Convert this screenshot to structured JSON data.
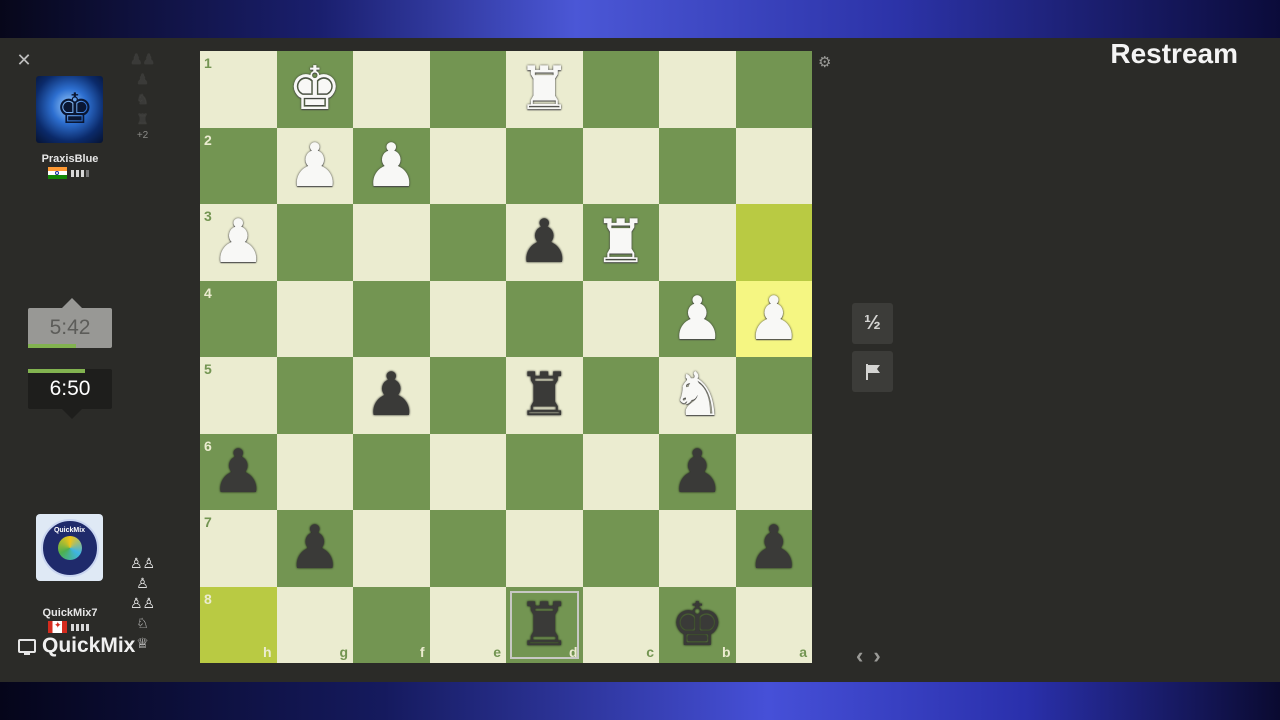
{
  "watermark": "Restream",
  "top_player": {
    "name": "PraxisBlue",
    "flag": "india-flag",
    "captured": [
      "♟♟",
      "♟",
      "♞",
      "♜"
    ],
    "captured_extra": "+2",
    "clock": "5:42"
  },
  "bottom_player": {
    "name": "QuickMix7",
    "flag": "canada-flag",
    "avatar_text": "QuickMix",
    "captured": [
      "♙♙",
      "♙",
      "♙♙",
      "♘",
      "♕"
    ],
    "clock": "6:50"
  },
  "brand": "QuickMix",
  "controls": {
    "draw_label": "½",
    "resign_icon": "flag-icon",
    "prev": "‹",
    "next": "›"
  },
  "board": {
    "orientation": "black-bottom",
    "files": [
      "h",
      "g",
      "f",
      "e",
      "d",
      "c",
      "b",
      "a"
    ],
    "ranks": [
      "1",
      "2",
      "3",
      "4",
      "5",
      "6",
      "7",
      "8"
    ],
    "rows": [
      [
        "",
        "wK",
        "",
        "",
        "wR",
        "",
        "",
        ""
      ],
      [
        "",
        "wP",
        "wP",
        "",
        "",
        "",
        "",
        ""
      ],
      [
        "wP",
        "",
        "",
        "",
        "bP",
        "wR",
        "",
        ""
      ],
      [
        "",
        "",
        "",
        "",
        "",
        "",
        "wP",
        "wP"
      ],
      [
        "",
        "",
        "bP",
        "",
        "bR",
        "",
        "wN",
        ""
      ],
      [
        "bP",
        "",
        "",
        "",
        "",
        "",
        "bP",
        ""
      ],
      [
        "",
        "bP",
        "",
        "",
        "",
        "",
        "",
        "bP"
      ],
      [
        "",
        "",
        "",
        "",
        "bR",
        "",
        "bK",
        ""
      ]
    ],
    "highlights": [
      "a3",
      "a4",
      "h8"
    ],
    "selected": "d8"
  }
}
